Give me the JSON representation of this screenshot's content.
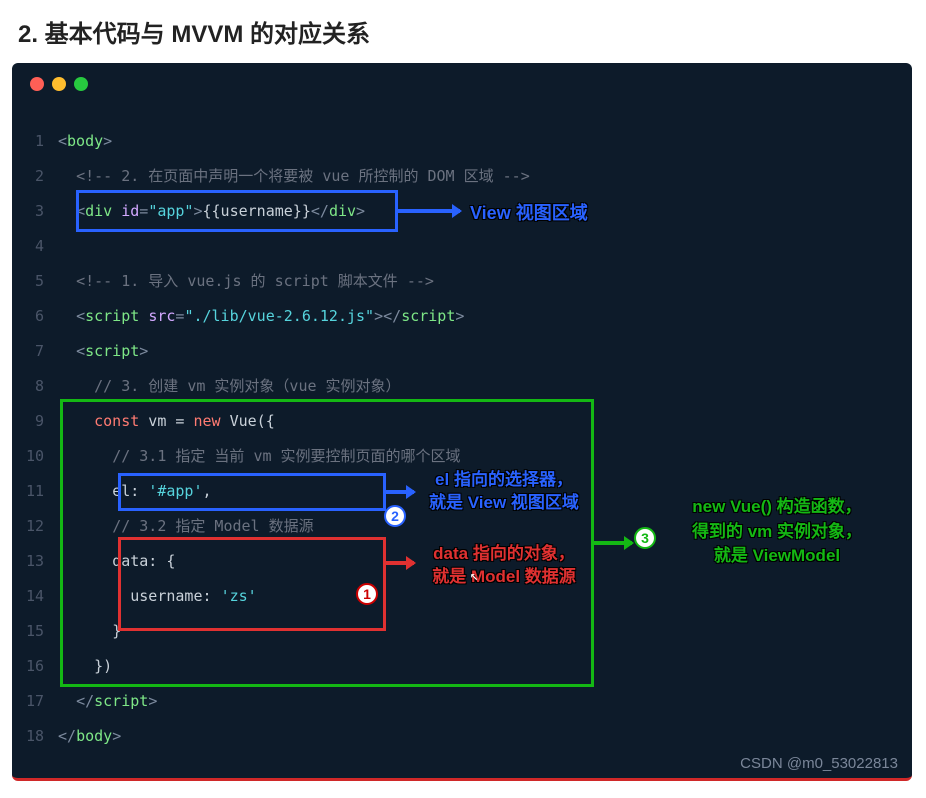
{
  "heading": "2. 基本代码与 MVVM 的对应关系",
  "code": {
    "l1": "<body>",
    "l2_comment": "<!-- 2. 在页面中声明一个将要被 vue 所控制的 DOM 区域 -->",
    "l3_open": "<div id=",
    "l3_attr": "\"app\"",
    "l3_mid": ">",
    "l3_text": "{{username}}",
    "l3_close": "</div>",
    "l5_comment": "<!-- 1. 导入 vue.js 的 script 脚本文件 -->",
    "l6_open": "<script src=",
    "l6_src": "\"./lib/vue-2.6.12.js\"",
    "l6_close": "></",
    "l6_close2": "script>",
    "l7": "<script>",
    "l8_comment": "// 3. 创建 vm 实例对象（vue 实例对象）",
    "l9_a": "const",
    "l9_b": " vm = ",
    "l9_c": "new",
    "l9_d": " Vue({",
    "l10_comment": "// 3.1 指定 当前 vm 实例要控制页面的哪个区域",
    "l11_a": "el: ",
    "l11_b": "'#app'",
    "l11_c": ",",
    "l12_comment": "// 3.2 指定 Model 数据源",
    "l13": "data: {",
    "l14_a": "username: ",
    "l14_b": "'zs'",
    "l15": "}",
    "l16": "})",
    "l17": "</",
    "l17b": "script>",
    "l18": "</body>"
  },
  "labels": {
    "view": "View 视图区域",
    "el_line1": "el 指向的选择器，",
    "el_line2": "就是 View 视图区域",
    "data_line1": "data 指向的对象，",
    "data_line2": "就是 Model 数据源",
    "vm_line1": "new Vue() 构造函数，",
    "vm_line2": "得到的 vm 实例对象，",
    "vm_line3": "就是 ViewModel"
  },
  "badges": {
    "one": "1",
    "two": "2",
    "three": "3"
  },
  "watermark": "CSDN @m0_53022813"
}
